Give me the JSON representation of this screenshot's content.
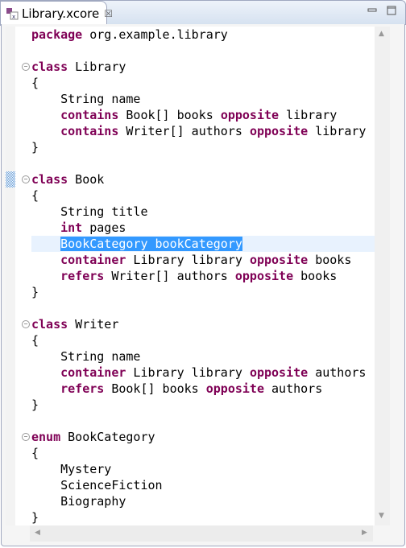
{
  "tab": {
    "title": "Library.xcore",
    "close_icon": "close-icon",
    "file_icon": "xcore-file-icon"
  },
  "window_buttons": [
    "minimize-icon",
    "maximize-icon"
  ],
  "colors": {
    "keyword": "#7f0055",
    "selection": "#3399ff",
    "current_line": "#e8f2fe"
  },
  "editor": {
    "current_line": 13,
    "lines": [
      [
        [
          "kw",
          "package"
        ],
        [
          "t",
          " org.example.library"
        ]
      ],
      [],
      [
        [
          "kw",
          "class"
        ],
        [
          "t",
          " Library"
        ]
      ],
      [
        [
          "t",
          "{"
        ]
      ],
      [
        [
          "t",
          "    String name"
        ]
      ],
      [
        [
          "t",
          "    "
        ],
        [
          "kw",
          "contains"
        ],
        [
          "t",
          " Book[] books "
        ],
        [
          "kw",
          "opposite"
        ],
        [
          "t",
          " library"
        ]
      ],
      [
        [
          "t",
          "    "
        ],
        [
          "kw",
          "contains"
        ],
        [
          "t",
          " Writer[] authors "
        ],
        [
          "kw",
          "opposite"
        ],
        [
          "t",
          " library"
        ]
      ],
      [
        [
          "t",
          "}"
        ]
      ],
      [],
      [
        [
          "kw",
          "class"
        ],
        [
          "t",
          " Book"
        ]
      ],
      [
        [
          "t",
          "{"
        ]
      ],
      [
        [
          "t",
          "    String title"
        ]
      ],
      [
        [
          "t",
          "    "
        ],
        [
          "kw",
          "int"
        ],
        [
          "t",
          " pages"
        ]
      ],
      [
        [
          "t",
          "    "
        ],
        [
          "sel",
          "BookCategory bookCategory"
        ]
      ],
      [
        [
          "t",
          "    "
        ],
        [
          "kw",
          "container"
        ],
        [
          "t",
          " Library library "
        ],
        [
          "kw",
          "opposite"
        ],
        [
          "t",
          " books"
        ]
      ],
      [
        [
          "t",
          "    "
        ],
        [
          "kw",
          "refers"
        ],
        [
          "t",
          " Writer[] authors "
        ],
        [
          "kw",
          "opposite"
        ],
        [
          "t",
          " books"
        ]
      ],
      [
        [
          "t",
          "}"
        ]
      ],
      [],
      [
        [
          "kw",
          "class"
        ],
        [
          "t",
          " Writer"
        ]
      ],
      [
        [
          "t",
          "{"
        ]
      ],
      [
        [
          "t",
          "    String name"
        ]
      ],
      [
        [
          "t",
          "    "
        ],
        [
          "kw",
          "container"
        ],
        [
          "t",
          " Library library "
        ],
        [
          "kw",
          "opposite"
        ],
        [
          "t",
          " authors"
        ]
      ],
      [
        [
          "t",
          "    "
        ],
        [
          "kw",
          "refers"
        ],
        [
          "t",
          " Book[] books "
        ],
        [
          "kw",
          "opposite"
        ],
        [
          "t",
          " authors"
        ]
      ],
      [
        [
          "t",
          "}"
        ]
      ],
      [],
      [
        [
          "kw",
          "enum"
        ],
        [
          "t",
          " BookCategory"
        ]
      ],
      [
        [
          "t",
          "{"
        ]
      ],
      [
        [
          "t",
          "    Mystery"
        ]
      ],
      [
        [
          "t",
          "    ScienceFiction"
        ]
      ],
      [
        [
          "t",
          "    Biography"
        ]
      ],
      [
        [
          "t",
          "}"
        ]
      ]
    ],
    "fold_lines": [
      2,
      9,
      18,
      25
    ]
  }
}
